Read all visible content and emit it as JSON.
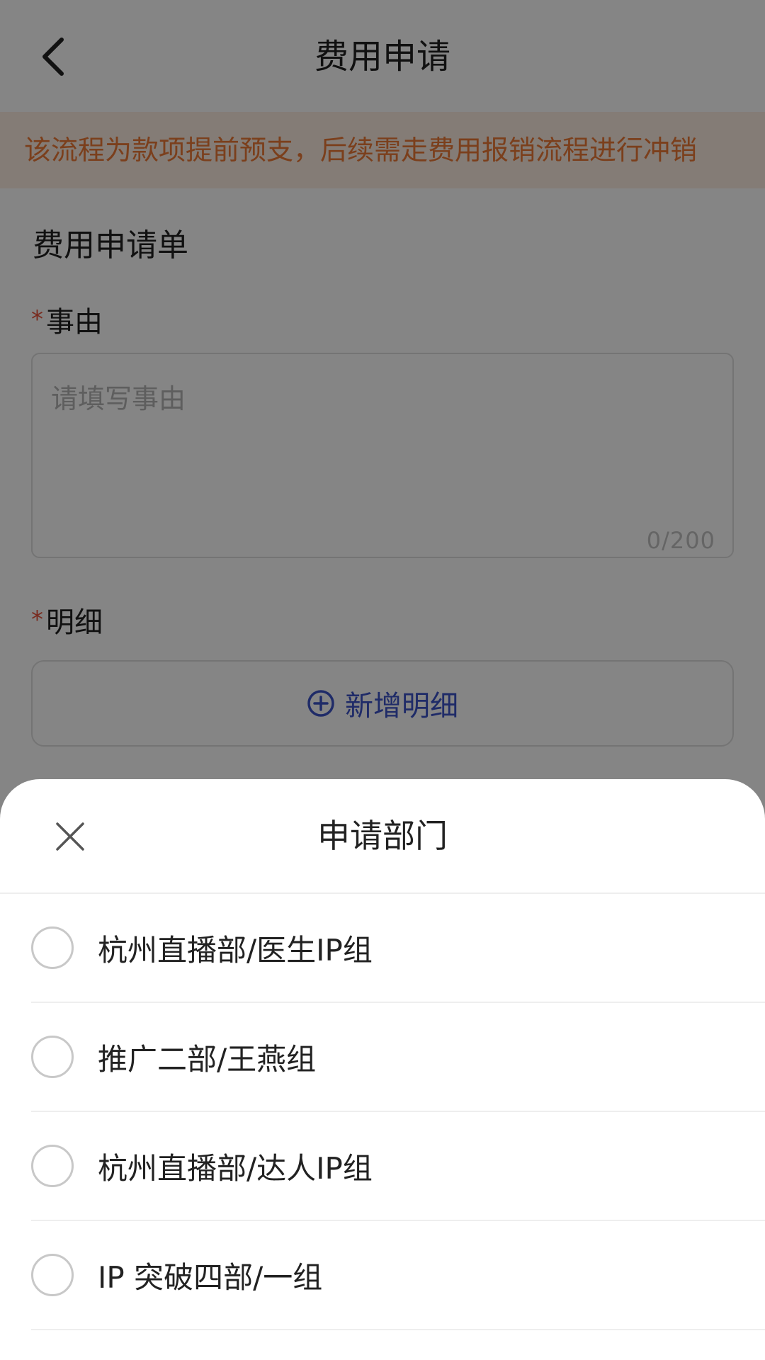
{
  "header": {
    "title": "费用申请"
  },
  "notice": {
    "text": "该流程为款项提前预支，后续需走费用报销流程进行冲销"
  },
  "form": {
    "title": "费用申请单",
    "required_mark": "*",
    "reason": {
      "label": "事由",
      "placeholder": "请填写事由",
      "counter": "0/200"
    },
    "detail": {
      "label": "明细",
      "add_button_label": "新增明细"
    }
  },
  "department_sheet": {
    "title": "申请部门",
    "options": [
      {
        "label": "杭州直播部/医生IP组",
        "selected": false
      },
      {
        "label": "推广二部/王燕组",
        "selected": false
      },
      {
        "label": "杭州直播部/达人IP组",
        "selected": false
      },
      {
        "label": "IP 突破四部/一组",
        "selected": false
      }
    ]
  },
  "colors": {
    "accent": "#3d54c8",
    "notice_text": "#ec7a36",
    "notice_bg": "#fdeee3",
    "required": "#e8553e"
  },
  "icons": {
    "back": "chevron-left-icon",
    "add": "plus-circle-icon",
    "close": "close-icon"
  }
}
